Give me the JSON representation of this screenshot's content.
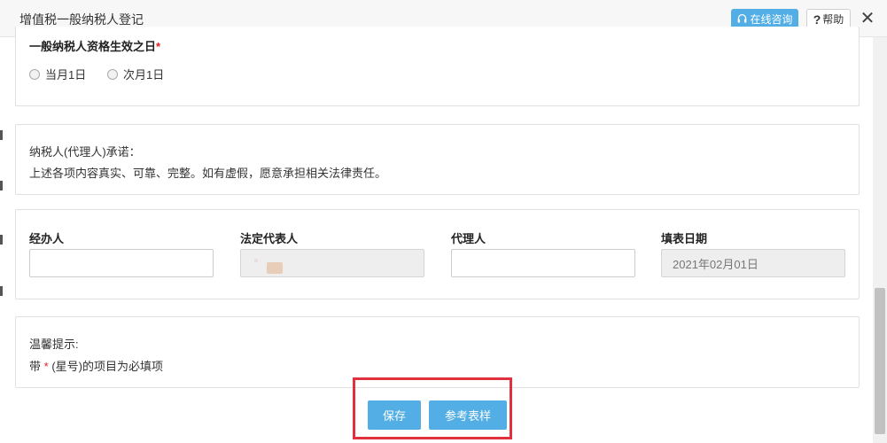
{
  "window": {
    "title": "增值税一般纳税人登记",
    "consult_label": "在线咨询",
    "help_label": "帮助",
    "close_symbol": "✕"
  },
  "effective_date": {
    "label": "一般纳税人资格生效之日",
    "required_mark": "*",
    "options": [
      "当月1日",
      "次月1日"
    ]
  },
  "promise": {
    "title": "纳税人(代理人)承诺：",
    "text": "上述各项内容真实、可靠、完整。如有虚假，愿意承担相关法律责任。"
  },
  "fields": [
    {
      "label": "经办人",
      "value": "",
      "disabled": false
    },
    {
      "label": "法定代表人",
      "value": "",
      "disabled": true
    },
    {
      "label": "代理人",
      "value": "",
      "disabled": false
    },
    {
      "label": "填表日期",
      "value": "2021年02月01日",
      "disabled": true
    }
  ],
  "tips": {
    "title": "温馨提示:",
    "prefix": "带",
    "star": "*",
    "suffix": "(星号)的项目为必填项"
  },
  "actions": {
    "save_label": "保存",
    "reference_label": "参考表样"
  },
  "colors": {
    "accent": "#52aee5",
    "required": "#e02020",
    "highlight_border": "#e0323e"
  }
}
